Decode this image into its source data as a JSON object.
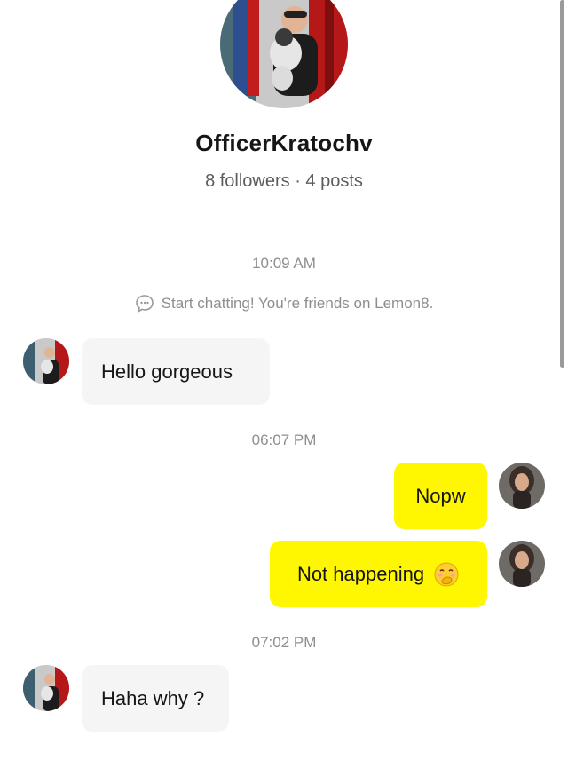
{
  "profile": {
    "name": "OfficerKratochv",
    "stats": "8 followers · 4 posts"
  },
  "chat": {
    "system_message": "Start chatting! You're friends on Lemon8.",
    "timestamps": [
      "10:09 AM",
      "06:07 PM",
      "07:02 PM"
    ],
    "messages": [
      {
        "from": "them",
        "text": "Hello gorgeous"
      },
      {
        "from": "me",
        "text": "Nopw"
      },
      {
        "from": "me",
        "text": "Not happening",
        "emoji": "face-with-hand-over-mouth"
      },
      {
        "from": "them",
        "text": "Haha why ?"
      }
    ]
  },
  "colors": {
    "outgoing_bubble": "#fff602",
    "incoming_bubble": "#f5f5f5",
    "muted_text": "#8e8e8e"
  }
}
